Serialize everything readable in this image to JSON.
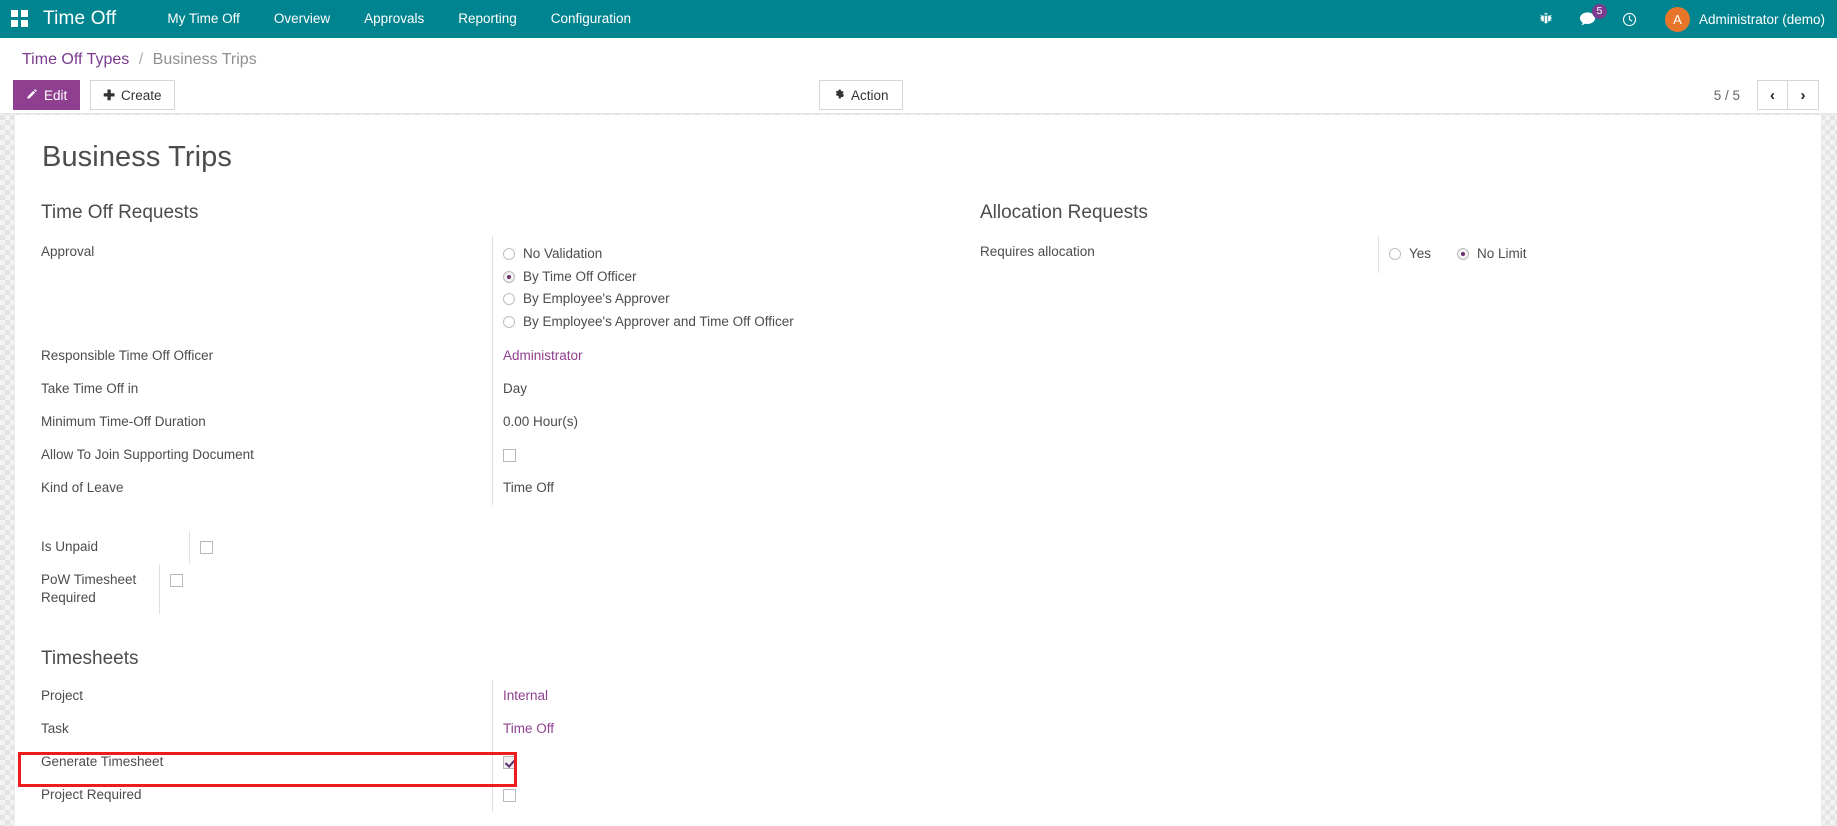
{
  "navbar": {
    "apps_icon": "apps-grid-icon",
    "brand": "Time Off",
    "menu": [
      {
        "label": "My Time Off"
      },
      {
        "label": "Overview"
      },
      {
        "label": "Approvals"
      },
      {
        "label": "Reporting"
      },
      {
        "label": "Configuration"
      }
    ],
    "icons": {
      "debug": "bug-icon",
      "messages": "chat-icon",
      "messages_badge": "5",
      "activities": "clock-icon"
    },
    "user": {
      "initial": "A",
      "name": "Administrator (demo)"
    },
    "background_color": "#00848f"
  },
  "control_panel": {
    "breadcrumb": {
      "parent": "Time Off Types",
      "separator": "/",
      "current": "Business Trips"
    },
    "edit_label": "Edit",
    "edit_icon": "pencil-icon",
    "create_label": "Create",
    "create_icon": "plus-icon",
    "action_label": "Action",
    "action_icon": "gear-icon",
    "pager": {
      "count": "5 / 5",
      "previous_icon": "chevron-left-icon",
      "next_icon": "chevron-right-icon"
    },
    "primary_color": "#8f3f8f"
  },
  "record": {
    "title": "Business Trips"
  },
  "time_off_requests": {
    "group_title": "Time Off Requests",
    "approval": {
      "label": "Approval",
      "options": [
        {
          "label": "No Validation",
          "selected": false
        },
        {
          "label": "By Time Off Officer",
          "selected": true
        },
        {
          "label": "By Employee's Approver",
          "selected": false
        },
        {
          "label": "By Employee's Approver and Time Off Officer",
          "selected": false
        }
      ]
    },
    "fields": [
      {
        "label": "Responsible Time Off Officer",
        "value": "Administrator",
        "type": "link"
      },
      {
        "label": "Take Time Off in",
        "value": "Day",
        "type": "text"
      },
      {
        "label": "Minimum Time-Off Duration",
        "value": "0.00 Hour(s)",
        "type": "text"
      },
      {
        "label": "Allow To Join Supporting Document",
        "value": "",
        "type": "checkbox",
        "checked": false
      },
      {
        "label": "Kind of Leave",
        "value": "Time Off",
        "type": "text"
      }
    ]
  },
  "allocation_requests": {
    "group_title": "Allocation Requests",
    "requires_allocation": {
      "label": "Requires allocation",
      "options": [
        {
          "label": "Yes",
          "selected": false
        },
        {
          "label": "No Limit",
          "selected": true
        }
      ]
    }
  },
  "extra_options": {
    "fields": [
      {
        "label": "Is Unpaid",
        "checked": false
      },
      {
        "label": "PoW Timesheet Required",
        "checked": false
      }
    ]
  },
  "timesheets": {
    "group_title": "Timesheets",
    "fields": [
      {
        "label": "Project",
        "value": "Internal",
        "type": "link"
      },
      {
        "label": "Task",
        "value": "Time Off",
        "type": "link"
      },
      {
        "label": "Generate Timesheet",
        "value": "",
        "type": "checkbox",
        "checked": true,
        "highlighted": true
      },
      {
        "label": "Project Required",
        "value": "",
        "type": "checkbox",
        "checked": false
      }
    ]
  },
  "annotation": {
    "highlight_color": "#ee1c1c",
    "target": "Generate Timesheet"
  }
}
